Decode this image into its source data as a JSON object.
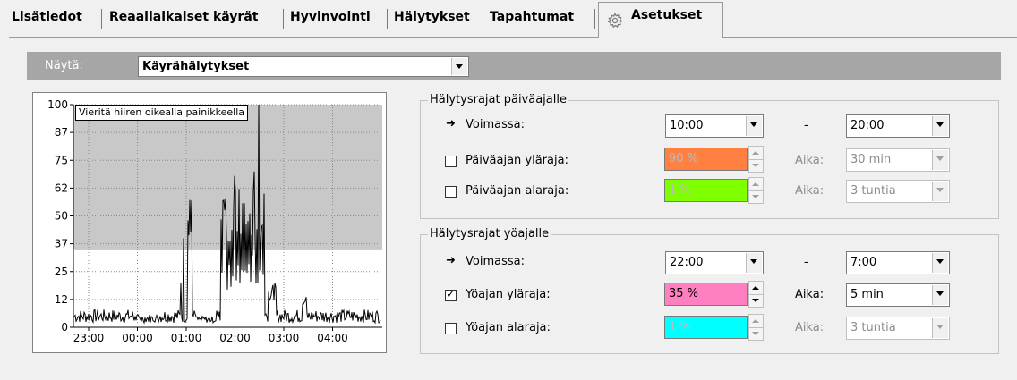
{
  "tabs": [
    {
      "label": "Lisätiedot"
    },
    {
      "label": "Reaaliaikaiset käyrät"
    },
    {
      "label": "Hyvinvointi"
    },
    {
      "label": "Hälytykset"
    },
    {
      "label": "Tapahtumat"
    },
    {
      "label": "Asetukset",
      "icon": "gear-icon",
      "active": true
    }
  ],
  "show": {
    "label": "Näytä:",
    "value": "Käyrähälytykset"
  },
  "chart_data": {
    "type": "line",
    "y_ticks": [
      "100",
      "87",
      "75",
      "62",
      "50",
      "37",
      "25",
      "12",
      "0"
    ],
    "x_ticks": [
      "23:00",
      "00:00",
      "01:00",
      "02:00",
      "03:00",
      "04:00"
    ],
    "ylim": [
      0,
      100
    ],
    "threshold": 35,
    "grid": true,
    "tooltip": "Vieritä hiiren oikealla painikkeella",
    "colors": {
      "band": "#c8c8c8",
      "threshold": "#ff80c0",
      "line": "#000000"
    }
  },
  "day": {
    "title": "Hälytysrajat päiväajalle",
    "active_label": "Voimassa:",
    "from": "10:00",
    "dash": "-",
    "to": "20:00",
    "upper": {
      "label": "Päiväajan yläraja:",
      "checked": false,
      "value": "90 %",
      "color": "#ff8040",
      "time_label": "Aika:",
      "time": "30 min"
    },
    "lower": {
      "label": "Päiväajan alaraja:",
      "checked": false,
      "value": "1 %",
      "color": "#80ff00",
      "time_label": "Aika:",
      "time": "3 tuntia"
    }
  },
  "night": {
    "title": "Hälytysrajat yöajalle",
    "active_label": "Voimassa:",
    "from": "22:00",
    "dash": "-",
    "to": "7:00",
    "upper": {
      "label": "Yöajan yläraja:",
      "checked": true,
      "value": "35 %",
      "color": "#ff80c0",
      "time_label": "Aika:",
      "time": "5 min"
    },
    "lower": {
      "label": "Yöajan alaraja:",
      "checked": false,
      "value": "1 %",
      "color": "#00ffff",
      "time_label": "Aika:",
      "time": "3 tuntia"
    }
  }
}
